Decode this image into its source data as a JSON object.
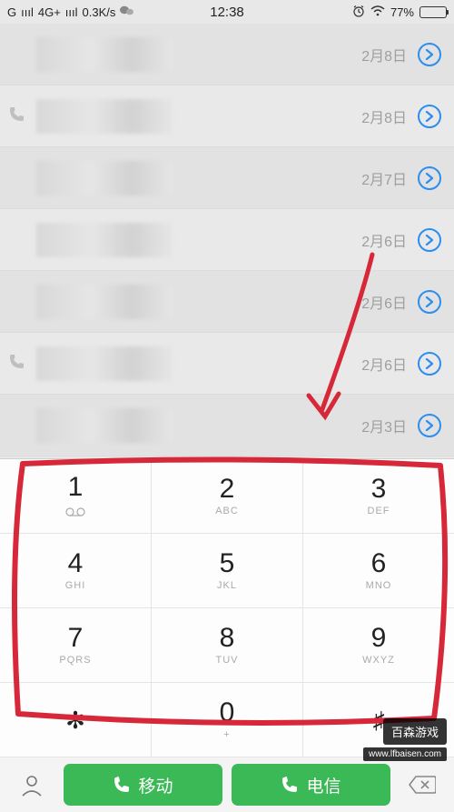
{
  "status": {
    "network": "G",
    "signal": "ıııl",
    "gen": "4G+",
    "signal2": "ıııl",
    "speed": "0.3K/s",
    "time": "12:38",
    "battery_pct": "77%"
  },
  "call_rows": [
    {
      "date": "2月8日",
      "has_icon": false
    },
    {
      "date": "2月8日",
      "has_icon": true
    },
    {
      "date": "2月7日",
      "has_icon": false
    },
    {
      "date": "2月6日",
      "has_icon": false
    },
    {
      "date": "2月6日",
      "has_icon": false
    },
    {
      "date": "2月6日",
      "has_icon": true
    },
    {
      "date": "2月3日",
      "has_icon": false
    }
  ],
  "keypad": [
    [
      {
        "d": "1",
        "l": "",
        "vm": true
      },
      {
        "d": "2",
        "l": "ABC"
      },
      {
        "d": "3",
        "l": "DEF"
      }
    ],
    [
      {
        "d": "4",
        "l": "GHI"
      },
      {
        "d": "5",
        "l": "JKL"
      },
      {
        "d": "6",
        "l": "MNO"
      }
    ],
    [
      {
        "d": "7",
        "l": "PQRS"
      },
      {
        "d": "8",
        "l": "TUV"
      },
      {
        "d": "9",
        "l": "WXYZ"
      }
    ],
    [
      {
        "d": "✻",
        "l": "",
        "sym": true
      },
      {
        "d": "0",
        "l": "+"
      },
      {
        "d": "♯",
        "l": "",
        "sym": true
      }
    ]
  ],
  "bottom": {
    "call1_label": "移动",
    "call2_label": "电信"
  },
  "watermark": {
    "main": "百森游戏",
    "sub": "www.lfbaisen.com"
  }
}
